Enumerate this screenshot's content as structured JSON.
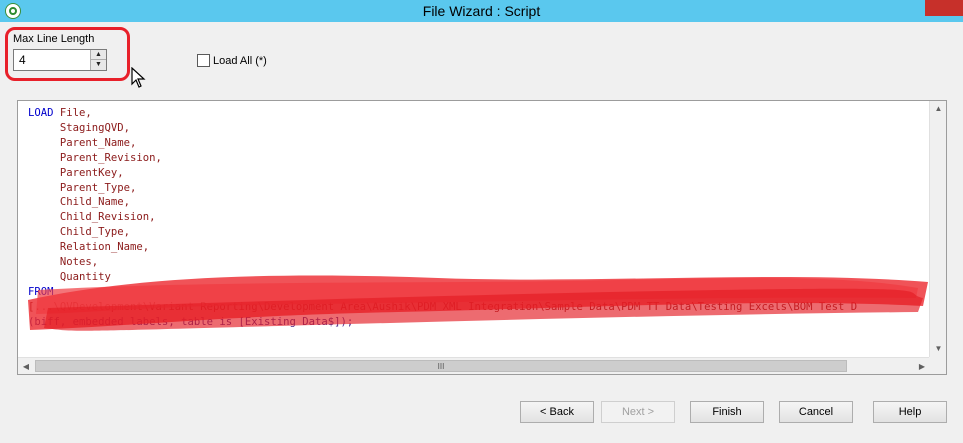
{
  "window": {
    "title": "File Wizard : Script"
  },
  "max_line_length": {
    "label": "Max Line Length",
    "value": "4"
  },
  "load_all": {
    "label": "Load All (*)",
    "checked": false
  },
  "script": {
    "load_keyword": "LOAD",
    "fields": [
      "File,",
      "StagingQVD,",
      "Parent_Name,",
      "Parent_Revision,",
      "ParentKey,",
      "Parent_Type,",
      "Child_Name,",
      "Child_Revision,",
      "Child_Type,",
      "Relation_Name,",
      "Notes,",
      "Quantity"
    ],
    "from_keyword": "FROM",
    "from_path": "[...\\QVDevelopment\\Variant Reporting\\Development Area\\Aushik\\PDM XML Integration\\Sample Data\\PDM TT Data\\Testing Excels\\BOM Test D",
    "from_options": "(biff, embedded labels, table is [Existing Data$]);"
  },
  "scrollbar": {
    "grip": "III"
  },
  "buttons": {
    "back": "< Back",
    "next": "Next >",
    "finish": "Finish",
    "cancel": "Cancel",
    "help": "Help"
  },
  "colors": {
    "titlebar": "#5ac8ee",
    "keyword": "#0000cc",
    "field": "#8b1a1a",
    "annotation": "#e8202a"
  },
  "icons": {
    "app": "qlikview-logo-icon",
    "close": "close-icon",
    "cursor": "mouse-pointer-icon"
  }
}
